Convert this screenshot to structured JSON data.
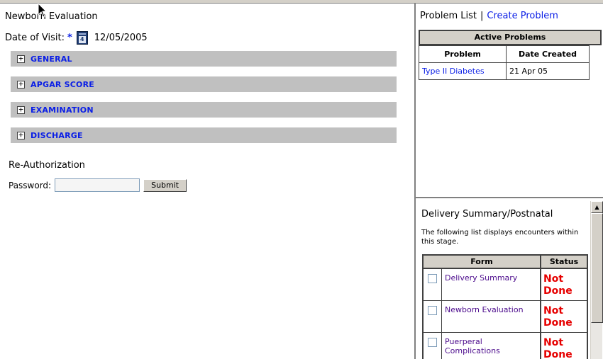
{
  "left": {
    "title": "Newborn Evaluation",
    "date_label": "Date of Visit:",
    "required_marker": "*",
    "calendar_day": "4",
    "date_value": "12/05/2005",
    "sections": [
      {
        "label": "GENERAL",
        "icon": "plus-expand-icon"
      },
      {
        "label": "APGAR SCORE",
        "icon": "plus-expand-icon"
      },
      {
        "label": "EXAMINATION",
        "icon": "plus-expand-icon"
      },
      {
        "label": "DISCHARGE",
        "icon": "plus-expand-icon"
      }
    ],
    "plus_glyph": "+",
    "reauth": {
      "title": "Re-Authorization",
      "password_label": "Password:",
      "password_value": "",
      "submit_label": "Submit"
    }
  },
  "problems": {
    "heading": "Problem List",
    "separator": "|",
    "create_link": "Create Problem",
    "active_header": "Active Problems",
    "columns": [
      "Problem",
      "Date Created"
    ],
    "rows": [
      {
        "problem": "Type II Diabetes",
        "date": "21 Apr 05"
      }
    ]
  },
  "delivery": {
    "title": "Delivery Summary/Postnatal",
    "description": "The following list displays encounters within this stage.",
    "columns": [
      "Form",
      "Status"
    ],
    "rows": [
      {
        "form": "Delivery Summary",
        "status": "Not Done"
      },
      {
        "form": "Newborn Evaluation",
        "status": "Not Done"
      },
      {
        "form": "Puerperal Complications",
        "status": "Not Done"
      }
    ]
  },
  "colors": {
    "link_blue": "#0a1ee6",
    "status_red": "#e60000",
    "section_gray": "#c0c0c0",
    "visited_purple": "#4b0a8c"
  },
  "scrollbar": {
    "up_glyph": "▲"
  }
}
